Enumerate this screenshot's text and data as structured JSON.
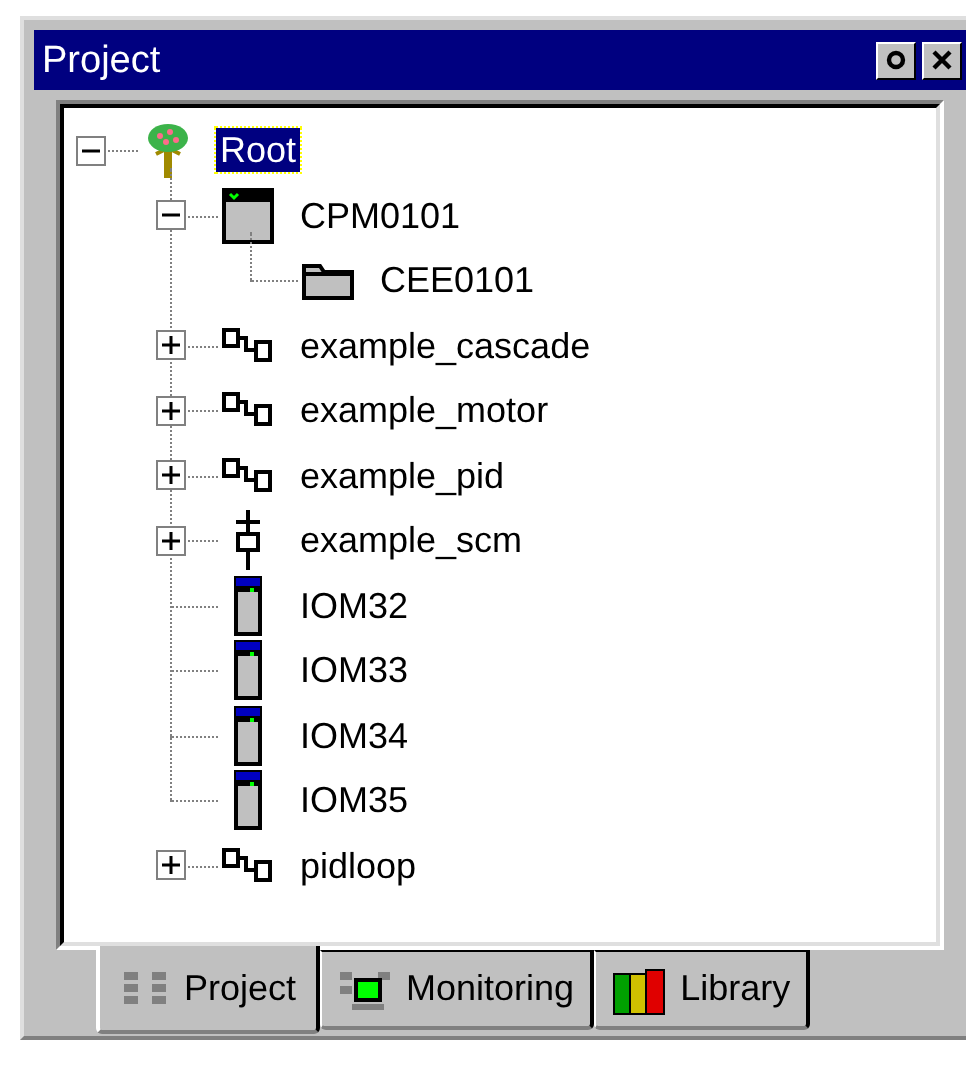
{
  "window": {
    "title": "Project"
  },
  "tree": [
    {
      "label": "Root",
      "kind": "root",
      "selected": true,
      "expanded": true,
      "children": [
        {
          "label": "CPM0101",
          "kind": "controller",
          "selected": false,
          "expanded": true,
          "children": [
            {
              "label": "CEE0101",
              "kind": "environment",
              "selected": false
            }
          ]
        },
        {
          "label": "example_cascade",
          "kind": "strategy",
          "selected": false,
          "expanded": false
        },
        {
          "label": "example_motor",
          "kind": "strategy",
          "selected": false,
          "expanded": false
        },
        {
          "label": "example_pid",
          "kind": "strategy",
          "selected": false,
          "expanded": false
        },
        {
          "label": "example_scm",
          "kind": "sequence",
          "selected": false,
          "expanded": false
        },
        {
          "label": "IOM32",
          "kind": "module",
          "selected": false
        },
        {
          "label": "IOM33",
          "kind": "module",
          "selected": false
        },
        {
          "label": "IOM34",
          "kind": "module",
          "selected": false
        },
        {
          "label": "IOM35",
          "kind": "module",
          "selected": false
        },
        {
          "label": "pidloop",
          "kind": "strategy",
          "selected": false,
          "expanded": false
        }
      ]
    }
  ],
  "tabs": [
    {
      "label": "Project",
      "kind": "project",
      "selected": true
    },
    {
      "label": "Monitoring",
      "kind": "monitoring",
      "selected": false
    },
    {
      "label": "Library",
      "kind": "library",
      "selected": false
    }
  ]
}
